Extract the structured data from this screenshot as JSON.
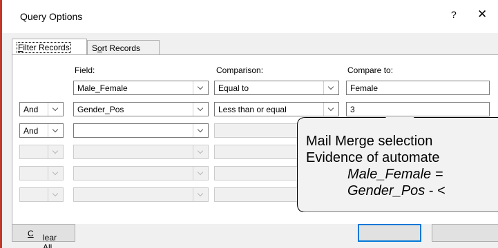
{
  "window": {
    "title": "Query Options",
    "help": "?",
    "close": "✕"
  },
  "tabs": [
    {
      "label_underline": "F",
      "label_rest": "ilter Records"
    },
    {
      "label_pre": "S",
      "label_underline": "o",
      "label_rest": "rt Records"
    }
  ],
  "headers": {
    "field": "Field:",
    "comparison": "Comparison:",
    "compare_to": "Compare to:"
  },
  "rows": [
    {
      "conj": "",
      "field": "Male_Female",
      "comparison": "Equal to",
      "value": "Female"
    },
    {
      "conj": "And",
      "field": "Gender_Pos",
      "comparison": "Less than or equal",
      "value": "3"
    },
    {
      "conj": "And",
      "field": "",
      "comparison": "",
      "value": ""
    },
    {
      "conj": "",
      "field": "",
      "comparison": "",
      "value": ""
    },
    {
      "conj": "",
      "field": "",
      "comparison": "",
      "value": ""
    },
    {
      "conj": "",
      "field": "",
      "comparison": "",
      "value": ""
    }
  ],
  "buttons": {
    "clear_all_underline": "C",
    "clear_all_rest": "lear All"
  },
  "callout": {
    "line1": "Mail Merge selection",
    "line2": "Evidence of automate",
    "line3": "Male_Female =",
    "line4_italic": "Gender_Pos",
    "line4_rest": " - <"
  },
  "colors": {
    "accent": "#0078d7",
    "dialog_bg": "#f0f0f0"
  }
}
